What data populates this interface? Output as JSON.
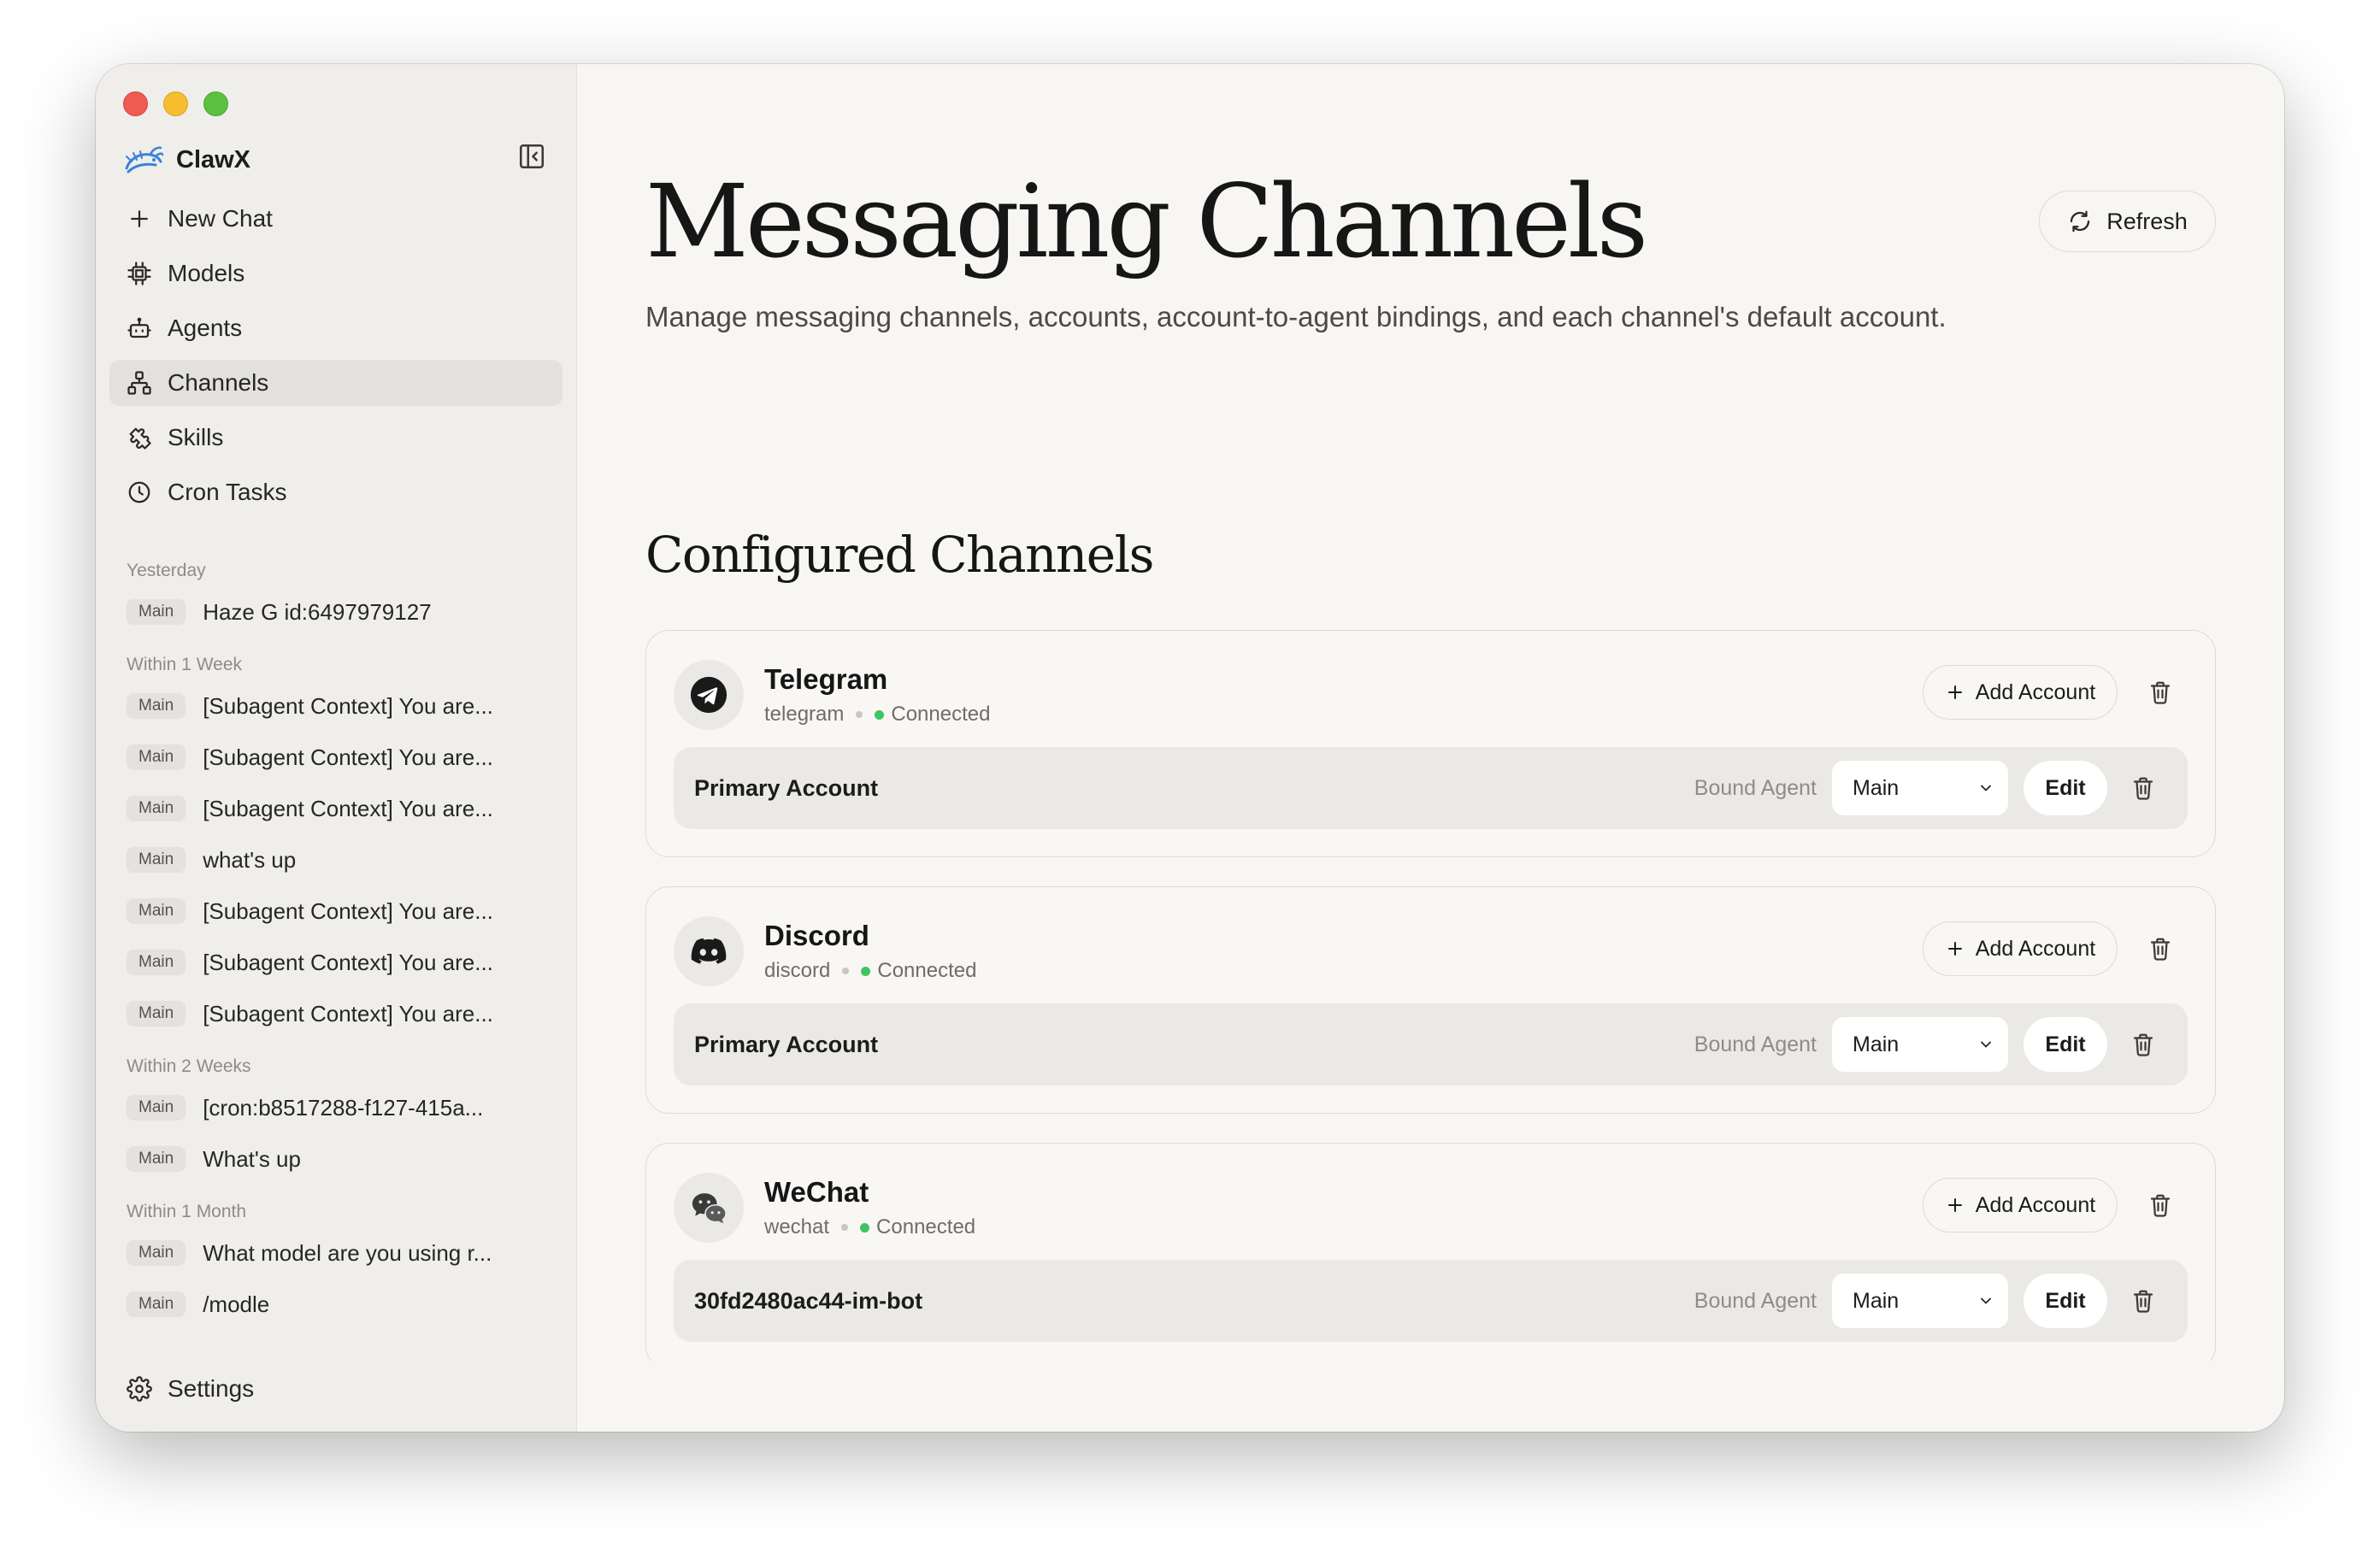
{
  "app": {
    "name": "ClawX"
  },
  "sidebar": {
    "nav": [
      {
        "label": "New Chat",
        "icon": "plus-icon"
      },
      {
        "label": "Models",
        "icon": "chip-icon"
      },
      {
        "label": "Agents",
        "icon": "bot-icon"
      },
      {
        "label": "Channels",
        "icon": "network-icon",
        "active": true
      },
      {
        "label": "Skills",
        "icon": "puzzle-icon"
      },
      {
        "label": "Cron Tasks",
        "icon": "clock-icon"
      }
    ],
    "history_groups": [
      {
        "label": "Yesterday",
        "items": [
          {
            "badge": "Main",
            "title": "Haze G id:6497979127"
          }
        ]
      },
      {
        "label": "Within 1 Week",
        "items": [
          {
            "badge": "Main",
            "title": "[Subagent Context] You are..."
          },
          {
            "badge": "Main",
            "title": "[Subagent Context] You are..."
          },
          {
            "badge": "Main",
            "title": "[Subagent Context] You are..."
          },
          {
            "badge": "Main",
            "title": "what's up"
          },
          {
            "badge": "Main",
            "title": "[Subagent Context] You are..."
          },
          {
            "badge": "Main",
            "title": "[Subagent Context] You are..."
          },
          {
            "badge": "Main",
            "title": "[Subagent Context] You are..."
          }
        ]
      },
      {
        "label": "Within 2 Weeks",
        "items": [
          {
            "badge": "Main",
            "title": "[cron:b8517288-f127-415a..."
          },
          {
            "badge": "Main",
            "title": "What's up"
          }
        ]
      },
      {
        "label": "Within 1 Month",
        "items": [
          {
            "badge": "Main",
            "title": "What model are you using r..."
          },
          {
            "badge": "Main",
            "title": "/modle"
          }
        ]
      }
    ],
    "settings_label": "Settings"
  },
  "main": {
    "title": "Messaging Channels",
    "subtitle": "Manage messaging channels, accounts, account-to-agent bindings, and each channel's default account.",
    "refresh_label": "Refresh",
    "section_title": "Configured Channels",
    "channels": [
      {
        "name": "Telegram",
        "id": "telegram",
        "status": "Connected",
        "icon": "telegram-icon",
        "add_label": "Add Account",
        "account": {
          "name": "Primary Account",
          "bound_label": "Bound Agent",
          "agent": "Main",
          "edit_label": "Edit"
        }
      },
      {
        "name": "Discord",
        "id": "discord",
        "status": "Connected",
        "icon": "discord-icon",
        "add_label": "Add Account",
        "account": {
          "name": "Primary Account",
          "bound_label": "Bound Agent",
          "agent": "Main",
          "edit_label": "Edit"
        }
      },
      {
        "name": "WeChat",
        "id": "wechat",
        "status": "Connected",
        "icon": "wechat-icon",
        "add_label": "Add Account",
        "account": {
          "name": "30fd2480ac44-im-bot",
          "bound_label": "Bound Agent",
          "agent": "Main",
          "edit_label": "Edit"
        }
      }
    ]
  },
  "colors": {
    "status_connected": "#3ec463",
    "sidebar_bg": "#efeeeb",
    "main_bg": "#f7f6f3",
    "active_nav_bg": "#e3e1dd"
  }
}
